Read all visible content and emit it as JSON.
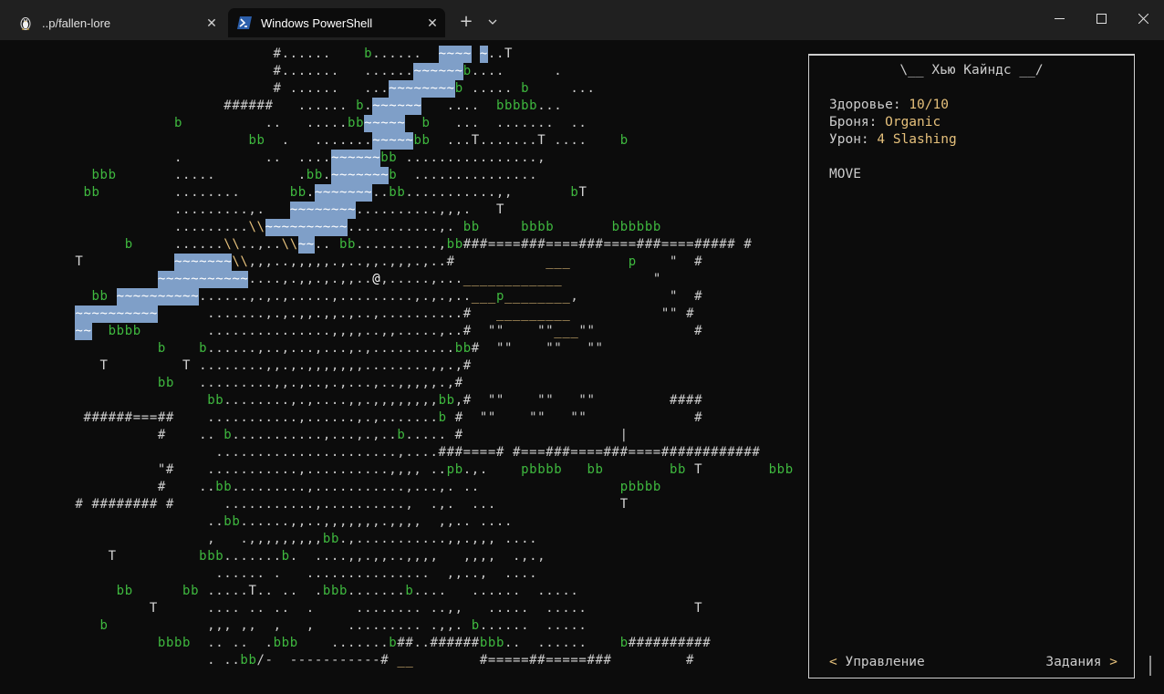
{
  "tabs": [
    {
      "label": "..p/fallen-lore",
      "icon": "linux-penguin-icon",
      "active": false
    },
    {
      "label": "Windows PowerShell",
      "icon": "powershell-icon",
      "active": true
    }
  ],
  "new_tab": "+",
  "tab_dropdown": "⌄",
  "window_controls": {
    "minimize": "—",
    "maximize": "☐",
    "close": "✕"
  },
  "colors": {
    "background": "#0c0c0c",
    "default_text": "#cccccc",
    "green": "#3fb93f",
    "yellow": "#e5c07b",
    "water": "#7f9fc8",
    "tree_bg": "#8fbf6f",
    "white": "#ffffff"
  },
  "map_rows": [
    "                                #......    b......  ~~~~ ~..T",
    "                                #.......   ......~~~~~~b....      .",
    "                                # ......   ...~~~~~~~~b ..... b     ...",
    "                          ######   ...... b.~~~~~~   ....  bbbbb...",
    "                    b          ..   .....bb~~~~~  b   ...  .......  ..",
    "                             bb  .   .......~~~~~bb  ...T.......T ....    b",
    "                    .          ..  ....~~~~~~bb ................,",
    "          bbb       .....          .bb.~~~~~~~b  ...............",
    "         bb         ........      bb.~~~~~~~..bb...........,,       bT",
    "                    .........,.   ~~~~~~~~..........,,,.   T",
    "                    .........\\\\~~~~~~~~~~...........,. bb     bbbb       bbbbbb",
    "              b     ......\\\\..,..\\\\~~.. bb..........,bb###====###====###====###====##### #",
    "        T           ~~~~~~~\\\\,,,..,,,,,.,..,,.,,,.,..#           ___       p    \"  #",
    "                  ~~~~~~~~~~~....,.,,.,.,,..@,.....,...____________           \"",
    "          bb ~~~~~~~~~~......,.,.,.....,.........,.,.,..___p________,           \"  #",
    "        ~~~~~~~~~~      .......,.,.,,.,,.,..,..........#   _________           \"\" #",
    "        ~~  bbbb        ...............,,,,..,,.....,..#  \"\"    \"\"___\"\"            #",
    "                  b    b......,..,...,...,.,..........bb#  \"\"    \"\"   \"\"",
    "           T         T ........,,.,.,,,,,,,........,,.,#",
    "                  bb   .........,,.,..,.,...,..,,,,,.,#",
    "                        bb........,.,....,,.,,,,,,,,bb,#  \"\"    \"\"   \"\"         ####",
    "         ######===##    ...........,......,.,.......b #  \"\"    \"\"   \"\"             #",
    "                  #    .. b...........,...,.,..b..... #                   |",
    "                         ......................,....###====# #===###====###====############",
    "                  \"#    ...........,..........,,,, ..pb.,.    pbbbb   bb        bb T        bbb",
    "                  #    ..bb.........,...........,...,. ..                 pbbbb",
    "        # ######## #      ...........,..........,  .,.  ...               T",
    "                        ..bb......,,..,,,,,,,.,,,,  ,,.. ....",
    "                        ,   .,,,,,,,,,bb.,...........,,.,,, ....",
    "            T          bbb.......b.  ....,,.,,..,,,,   ,,,,  .,.,",
    "                         ...... .   ...............  ,,..,  ....",
    "             bb      bb .....T.. ..  .bbb.......b....   ......  .....",
    "                 T      .... .. ..  .     ........ ..,,   .....  .....             T",
    "           b            ,,, ,,  ,   ,    ......... .,,. b......  .....",
    "                  bbbb  .. ..  .bbb    .......b##..######bbb..  ......    b##########",
    "                        . ..bb/-  -----------# __        #=====##=====###         #"
  ],
  "panel": {
    "title": "\\__ Хью Кайндс __/",
    "health_label": "Здоровье: ",
    "health_value": "10/10",
    "armor_label": "Броня: ",
    "armor_value": "Organic",
    "damage_label": "Урон: ",
    "damage_value": "4 Slashing",
    "mode": "MOVE",
    "footer_left_arrow": "<",
    "footer_left_label": " Управление",
    "footer_right_label": "Задания ",
    "footer_right_arrow": ">"
  }
}
